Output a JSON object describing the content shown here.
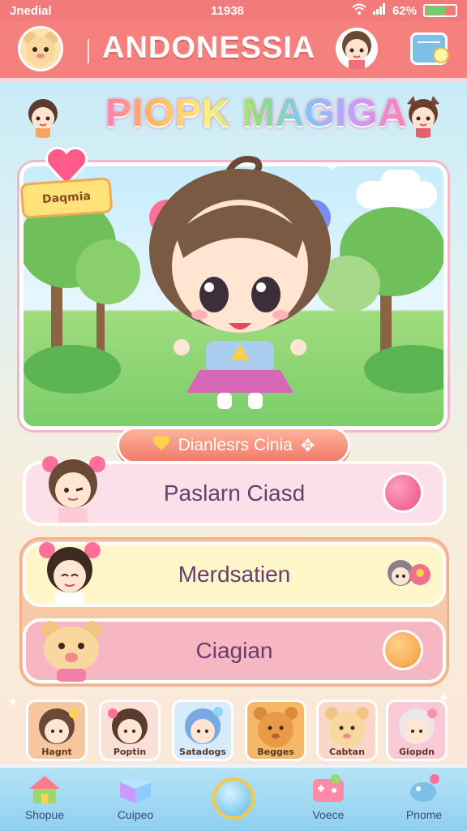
{
  "status_bar": {
    "carrier": "Jnedial",
    "time": "11938",
    "battery": "62%",
    "battery_level": 0.62
  },
  "header": {
    "title": "ANDONESSIA"
  },
  "logo": {
    "text": "PIOPK MAGIGA"
  },
  "stage": {
    "banner": "Daqmia"
  },
  "section": {
    "label": "Dianlesrs Cinia"
  },
  "menu": [
    {
      "label": "Paslarn Ciasd",
      "color": "#fbe0ea"
    },
    {
      "label": "Merdsatien",
      "color": "#fff6c9"
    },
    {
      "label": "Ciagian",
      "color": "#f7b7c2"
    }
  ],
  "characters": [
    {
      "name": "Hagnt",
      "bg": "#f6c79f"
    },
    {
      "name": "Poptin",
      "bg": "#fbe0d7"
    },
    {
      "name": "Satadogs",
      "bg": "#d6ecfb"
    },
    {
      "name": "Begges",
      "bg": "#f6b766"
    },
    {
      "name": "Cabtan",
      "bg": "#fbd7c9"
    },
    {
      "name": "Giopdn",
      "bg": "#f9c9d6"
    }
  ],
  "nav": [
    {
      "label": "Shopue",
      "icon": "house-icon"
    },
    {
      "label": "Cuipeo",
      "icon": "box-icon"
    },
    {
      "label": "",
      "icon": "compass-icon"
    },
    {
      "label": "Voece",
      "icon": "gamepad-icon"
    },
    {
      "label": "Pnome",
      "icon": "bird-icon"
    }
  ]
}
